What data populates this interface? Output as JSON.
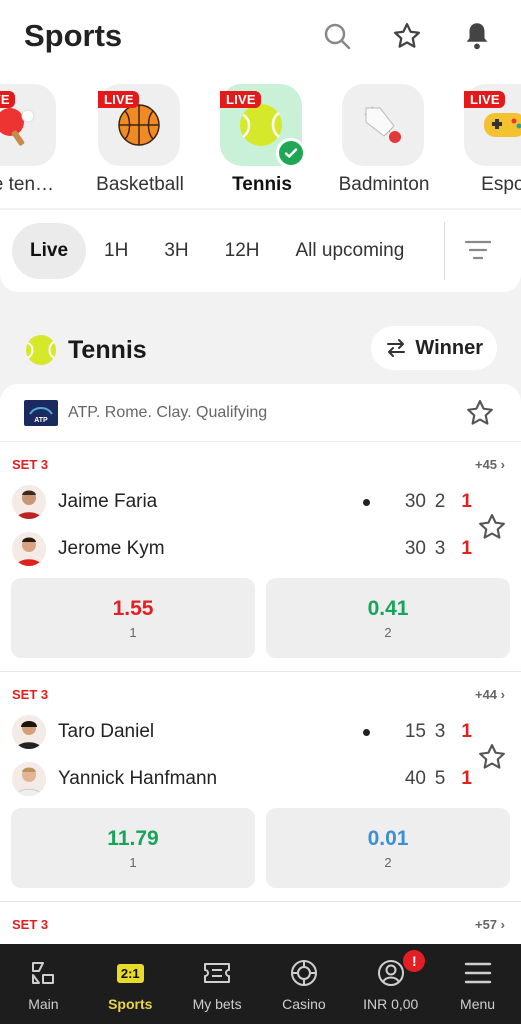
{
  "header": {
    "title": "Sports"
  },
  "sports": [
    {
      "label": "ole ten…",
      "live": "LIVE"
    },
    {
      "label": "Basketball",
      "live": "LIVE"
    },
    {
      "label": "Tennis",
      "live": "LIVE",
      "active": true
    },
    {
      "label": "Badminton"
    },
    {
      "label": "Espor",
      "live": "LIVE"
    }
  ],
  "filters": [
    "Live",
    "1H",
    "3H",
    "12H",
    "All upcoming"
  ],
  "section": {
    "title": "Tennis",
    "winner_label": "Winner"
  },
  "league": {
    "name": "ATP. Rome. Clay. Qualifying",
    "logo_text": "ATP"
  },
  "matches": [
    {
      "set": "SET 3",
      "more": "+45",
      "p1": {
        "name": "Jaime Faria",
        "game": "30",
        "set": "2",
        "cur": "1"
      },
      "p2": {
        "name": "Jerome Kym",
        "game": "30",
        "set": "3",
        "cur": "1"
      },
      "odd1": {
        "value": "1.55",
        "label": "1"
      },
      "odd2": {
        "value": "0.41",
        "label": "2"
      }
    },
    {
      "set": "SET 3",
      "more": "+44",
      "p1": {
        "name": "Taro Daniel",
        "game": "15",
        "set": "3",
        "cur": "1"
      },
      "p2": {
        "name": "Yannick Hanfmann",
        "game": "40",
        "set": "5",
        "cur": "1"
      },
      "odd1": {
        "value": "11.79",
        "label": "1"
      },
      "odd2": {
        "value": "0.01",
        "label": "2"
      }
    },
    {
      "set": "SET 3",
      "more": "+57"
    }
  ],
  "nav": [
    {
      "label": "Main"
    },
    {
      "label": "Sports",
      "badge": "2:1"
    },
    {
      "label": "My bets"
    },
    {
      "label": "Casino"
    },
    {
      "label": "INR 0,00",
      "notif": "!"
    },
    {
      "label": "Menu"
    }
  ],
  "colors": {
    "live_red": "#e41a1a",
    "accent_green": "#1ea856",
    "odd_up": "#e31e24",
    "odd_down": "#17a35a",
    "odd_neutral": "#3c8fd1",
    "nav_bg": "#1d1d1d",
    "nav_active": "#e8d44a"
  }
}
